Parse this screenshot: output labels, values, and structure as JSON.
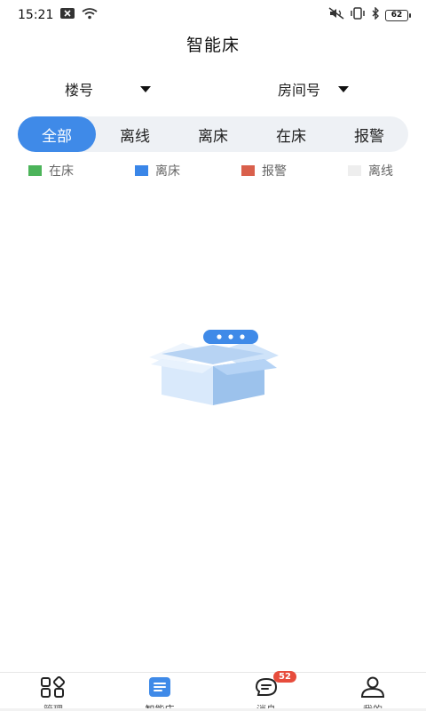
{
  "status_bar": {
    "time": "15:21",
    "battery": "62",
    "icons": [
      "notification-x-icon",
      "wifi-icon",
      "mute-icon",
      "vibrate-icon",
      "bluetooth-icon",
      "battery-icon"
    ]
  },
  "header": {
    "title": "智能床"
  },
  "filters": {
    "building_label": "楼号",
    "room_label": "房间号"
  },
  "tabs": [
    {
      "label": "全部",
      "active": true
    },
    {
      "label": "离线",
      "active": false
    },
    {
      "label": "离床",
      "active": false
    },
    {
      "label": "在床",
      "active": false
    },
    {
      "label": "报警",
      "active": false
    }
  ],
  "legend": [
    {
      "label": "在床",
      "color": "#4cb45a"
    },
    {
      "label": "离床",
      "color": "#3a86e8"
    },
    {
      "label": "报警",
      "color": "#d9604c"
    },
    {
      "label": "离线",
      "color": "#eeeeee"
    }
  ],
  "bottom_nav": [
    {
      "label": "管理",
      "icon": "grid-icon",
      "active": false
    },
    {
      "label": "智能床",
      "icon": "list-icon",
      "active": true
    },
    {
      "label": "消息",
      "icon": "chat-icon",
      "active": false,
      "badge": "52"
    },
    {
      "label": "我的",
      "icon": "user-icon",
      "active": false
    }
  ]
}
